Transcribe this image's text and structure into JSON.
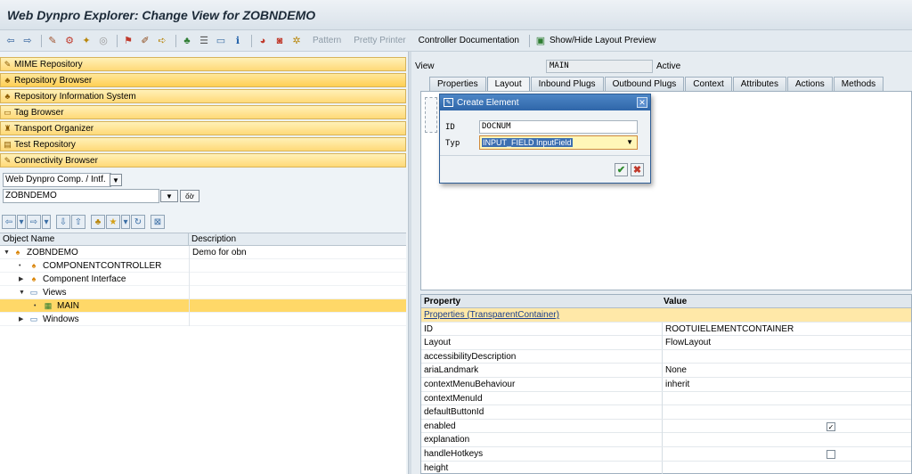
{
  "window": {
    "title": "Web Dynpro Explorer: Change View for ZOBNDEMO"
  },
  "toolbar": {
    "icons": [
      "back-icon",
      "forward-icon",
      "other-object-icon",
      "display-change-icon",
      "activate-icon",
      "check-icon",
      "where-used-icon",
      "object-list-icon",
      "edit-icon",
      "info-icon",
      "navigator-icon",
      "layout-icon",
      "grid-icon",
      "help-icon",
      "record-icon",
      "stop-icon",
      "wand-icon"
    ],
    "pattern": "Pattern",
    "pretty_printer": "Pretty Printer",
    "controller_doc": "Controller Documentation",
    "show_hide": "Show/Hide Layout Preview"
  },
  "nav": {
    "items": [
      {
        "label": "MIME Repository",
        "icon": "mime-icon"
      },
      {
        "label": "Repository Browser",
        "icon": "browser-icon"
      },
      {
        "label": "Repository Information System",
        "icon": "info-system-icon"
      },
      {
        "label": "Tag Browser",
        "icon": "tag-icon"
      },
      {
        "label": "Transport Organizer",
        "icon": "transport-icon"
      },
      {
        "label": "Test Repository",
        "icon": "test-icon"
      },
      {
        "label": "Connectivity Browser",
        "icon": "connectivity-icon"
      }
    ]
  },
  "object_type": "Web Dynpro Comp. / Intf.",
  "object_name": "ZOBNDEMO",
  "tree": {
    "columns": [
      "Object Name",
      "Description"
    ],
    "rows": [
      {
        "label": "ZOBNDEMO",
        "desc": "Demo for obn"
      },
      {
        "label": "COMPONENTCONTROLLER",
        "desc": ""
      },
      {
        "label": "Component Interface",
        "desc": ""
      },
      {
        "label": "Views",
        "desc": ""
      },
      {
        "label": "MAIN",
        "desc": ""
      },
      {
        "label": "Windows",
        "desc": ""
      }
    ]
  },
  "view": {
    "label": "View",
    "name": "MAIN",
    "status": "Active"
  },
  "tabs": [
    "Properties",
    "Layout",
    "Inbound Plugs",
    "Outbound Plugs",
    "Context",
    "Attributes",
    "Actions",
    "Methods"
  ],
  "properties": {
    "columns": [
      "Property",
      "Value"
    ],
    "group": "Properties (TransparentContainer)",
    "rows": [
      {
        "name": "ID",
        "value": "ROOTUIELEMENTCONTAINER"
      },
      {
        "name": "Layout",
        "value": "FlowLayout"
      },
      {
        "name": "accessibilityDescription",
        "value": ""
      },
      {
        "name": "ariaLandmark",
        "value": "None"
      },
      {
        "name": "contextMenuBehaviour",
        "value": "inherit"
      },
      {
        "name": "contextMenuId",
        "value": ""
      },
      {
        "name": "defaultButtonId",
        "value": ""
      },
      {
        "name": "enabled",
        "value": ""
      },
      {
        "name": "explanation",
        "value": ""
      },
      {
        "name": "handleHotkeys",
        "value": ""
      },
      {
        "name": "height",
        "value": ""
      }
    ],
    "enabled_checked": true,
    "handlehotkeys_checked": false
  },
  "dialog": {
    "title": "Create Element",
    "id_label": "ID",
    "id_value": "DOCNUM",
    "type_label": "Typ",
    "type_value": "INPUT_FIELD InputField"
  }
}
